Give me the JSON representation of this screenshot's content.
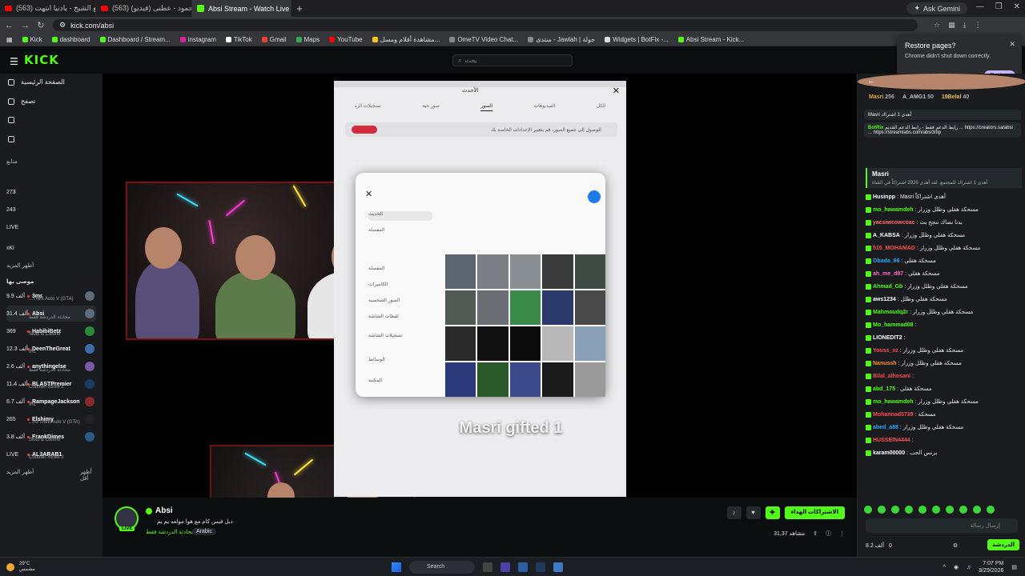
{
  "browser": {
    "tabs": [
      {
        "label": "(563) ودیع الشیخ - یادنیا انتهت...",
        "icon": "youtube-icon",
        "active": false
      },
      {
        "label": "(563) صباح محمود - عطنی (فیدیو)",
        "icon": "youtube-icon",
        "active": false
      },
      {
        "label": "Absi Stream - Watch Live o",
        "icon": "kick-icon",
        "active": true
      }
    ],
    "new_tab": "+",
    "ask_gemini": "Ask Gemini",
    "url": "kick.com/absi",
    "bookmarks": [
      "Kick",
      "dashboard",
      "Dashboard / Stream...",
      "instagram",
      "TikTok",
      "Gmail",
      "Maps",
      "YouTube",
      "مشاهدة أفلام ومسل...",
      "OmeTV Video Chat...",
      "منتدى - Jawlah | جولة",
      "Widgets | BotFix -...",
      "Absi Stream - Kick..."
    ]
  },
  "restore_popup": {
    "title": "Restore pages?",
    "message": "Chrome didn't shut down correctly.",
    "button": "Restore"
  },
  "kick": {
    "logo": "KICK",
    "search_placeholder": "بحث"
  },
  "sidebar": {
    "home": "الصفحة الرئيسية",
    "browse": "تصفح",
    "following_label": "متابع",
    "following": [
      {
        "count": "273"
      },
      {
        "count": "243"
      },
      {
        "count": "LIVE"
      },
      {
        "count": "xKi"
      }
    ],
    "show_more_1": "أظهر المزيد",
    "recommended_label": "موصى بها",
    "channels": [
      {
        "viewers": "9.9 ألف",
        "name": "3mr",
        "game": "...Theft Auto V (GTA)"
      },
      {
        "viewers": "31.4 ألف",
        "name": "Absi",
        "game": "محادثة الدردشة فقط"
      },
      {
        "viewers": "369",
        "name": "HabibiBetz",
        "game": "Slots & Casino"
      },
      {
        "viewers": "12.3 ألف",
        "name": "DeenTheGreat",
        "game": "IRL"
      },
      {
        "viewers": "2.6 ألف",
        "name": "anythingelse",
        "game": "محادثة الدردشة فقط"
      },
      {
        "viewers": "11.4 ألف",
        "name": "BLASTPremier",
        "game": "Counter-Strike 2"
      },
      {
        "viewers": "6.7 ألف",
        "name": "RampageJackson",
        "game": "IRL"
      },
      {
        "viewers": "265",
        "name": "Elshimy",
        "game": "...nd Theft Auto V (GTA)"
      },
      {
        "viewers": "3.8 ألف",
        "name": "FrankDimes",
        "game": "Slots & Casino"
      },
      {
        "viewers": "LIVE",
        "name": "AL3ARAB1",
        "game": "Counter-Strike 2"
      }
    ],
    "show_more_2": "أظهر المزيد",
    "show_less": "أظهر أقل"
  },
  "player": {
    "phone_header": "الأحدث",
    "phone_tabs": [
      "الكل",
      "الفيديوهات",
      "الصور",
      "صور حية",
      "تسجيلات الرد"
    ],
    "banner_text": "للوصول إلى جميع الصور، قم بتغيير الإعدادات الخاصة بك",
    "dialog_items": [
      "الحديث",
      "المفضلة",
      "المفضلة",
      "الكاميرات",
      "الصور الشخصية",
      "لقطات الشاشة",
      "تسجيلات الشاشة",
      "الوسائط",
      "المكتبة"
    ],
    "gift_message": "Masri gifted 1"
  },
  "stream_info": {
    "name": "Absi",
    "live_badge": "LIVE",
    "title": "دبل فيس كام مع هوا مولعه يم يم",
    "category": "محادثة الدردشة فقط",
    "tag": "Arabic",
    "subscribe_label": "الاشتراكات الهداء",
    "viewers": "31,37",
    "viewers_label": "مشاهد"
  },
  "chat": {
    "top_gifters": [
      {
        "name": "Masri",
        "count": "256",
        "color": "#e6a23c"
      },
      {
        "name": "A_AMG1",
        "count": "50",
        "color": "#c0c0c0"
      },
      {
        "name": "19Belal",
        "count": "40",
        "color": "#e6c24a"
      }
    ],
    "pinned_1": "Masri أهدى 1 اشتراك",
    "pinned_2_user": "BotRix",
    "pinned_2_text": "رابط الدعم فقط - رابط الدعم القديم ... https://creators.sa/absi ... https://streamlabs.com/absi3/tip",
    "gift_card_user": "Masri",
    "gift_card_text": "أهدى 1 اشتراك للمجتمع. لقد أهدى 2926 اشتراكاً في القناة",
    "messages": [
      {
        "user": "Husinpp",
        "text": "Masri أهدى اشتراكاً",
        "color": "#ffffff"
      },
      {
        "user": "mo_hawamdeh",
        "text": "مسحكة هقلي وظلل وزرار",
        "color": "#53fc18"
      },
      {
        "user": "yacsiwcowcoac",
        "text": "بدنا نضاك ننجح بث",
        "color": "#ff6b6b"
      },
      {
        "user": "A_KABSA",
        "text": "مسحكة هقلي وظلل وزرار",
        "color": "#ffffff"
      },
      {
        "user": "515_MOHAMAD",
        "text": "مسحكة هقلي وظلل وزرار",
        "color": "#ff4d4d"
      },
      {
        "user": "Obada_66",
        "text": "مسحكة هقلي",
        "color": "#2ea7ff"
      },
      {
        "user": "ah_me_d87",
        "text": "مسحكة هقلي",
        "color": "#ff66cc"
      },
      {
        "user": "Ahmad_Gb",
        "text": "مسحكة هقلي وظلل وزرار",
        "color": "#53fc18"
      },
      {
        "user": "aws1234",
        "text": "مسحكة هقلي وظلل",
        "color": "#ffffff"
      },
      {
        "user": "Mahmoudq2r",
        "text": "مسحكة هقلي وظلل وزرار",
        "color": "#53fc18"
      },
      {
        "user": "Mo_hammad08",
        "text": "",
        "color": "#53fc18"
      },
      {
        "user": "LIONEDIT2",
        "text": "",
        "color": "#ffffff"
      },
      {
        "user": "Youss_xz",
        "text": "مسحكة هقلي وظلل وزرار",
        "color": "#ff4d4d"
      },
      {
        "user": "Nanussh",
        "text": "مسحكة هقلي وظلل وزرار",
        "color": "#ff8c2e"
      },
      {
        "user": "Bilal_alhosani",
        "text": "",
        "color": "#ff4d4d"
      },
      {
        "user": "abd_175",
        "text": "مسحكة هقلي",
        "color": "#53fc18"
      },
      {
        "user": "mo_hawamdeh",
        "text": "مسحكة هقلي وظلل وزرار",
        "color": "#53fc18"
      },
      {
        "user": "Mohannad5739",
        "text": "مسحكة",
        "color": "#ff4d4d"
      },
      {
        "user": "abed_a88",
        "text": "مسحكة هقلي وظلل وزرار",
        "color": "#2ea7ff"
      },
      {
        "user": "HUSSEIN4444",
        "text": "",
        "color": "#ff4d4d"
      },
      {
        "user": "karam00000",
        "text": "برنس الحب",
        "color": "#ffffff"
      }
    ],
    "input_placeholder": "إرسال رسالة",
    "points": "8.2 ألف",
    "zero": "0",
    "send": "الدردشة"
  },
  "taskbar": {
    "temp": "29°C",
    "weather": "مشمس",
    "search": "Search",
    "time": "7:07 PM",
    "date": "8/29/2026"
  }
}
